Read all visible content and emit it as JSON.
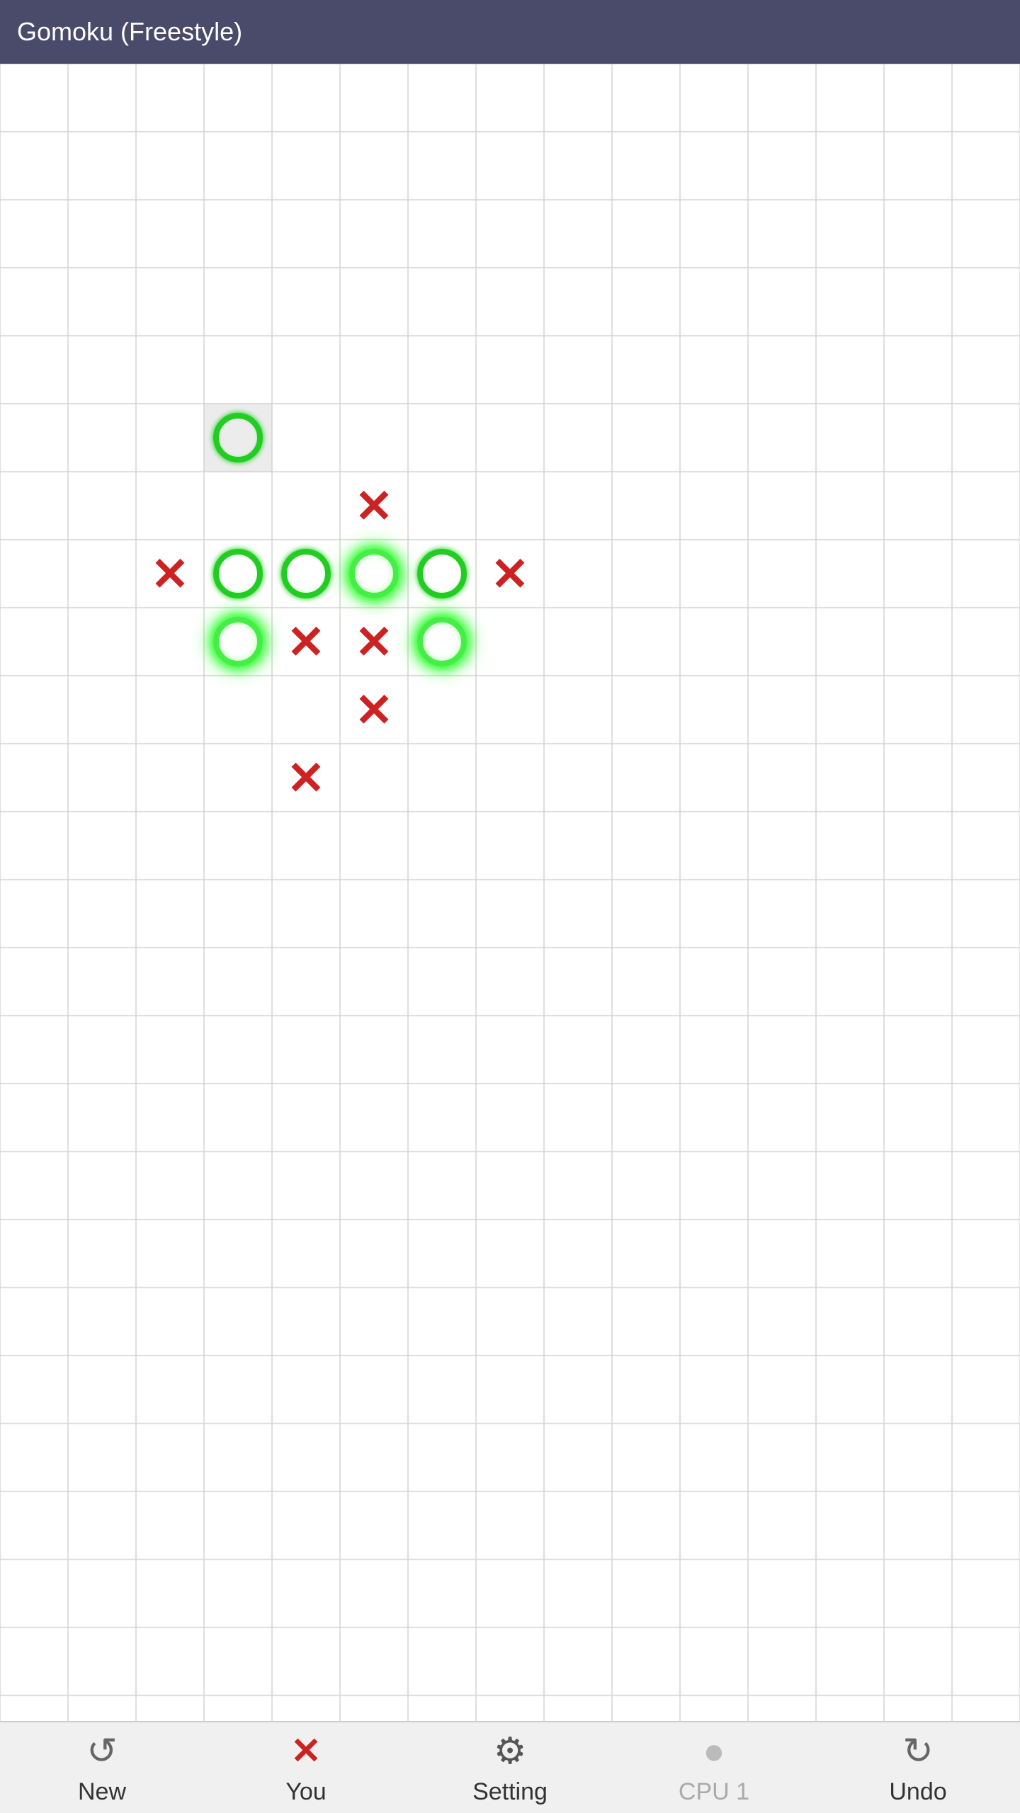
{
  "titleBar": {
    "title": "Gomoku (Freestyle)"
  },
  "board": {
    "cols": 15,
    "rows": 22,
    "cellSize": 96,
    "pieces": [
      {
        "type": "O",
        "col": 3,
        "row": 5,
        "highlighted": true,
        "bright": false
      },
      {
        "type": "X",
        "col": 5,
        "row": 6,
        "highlighted": false
      },
      {
        "type": "X",
        "col": 2,
        "row": 7,
        "highlighted": false
      },
      {
        "type": "O",
        "col": 3,
        "row": 7,
        "highlighted": false,
        "bright": false
      },
      {
        "type": "O",
        "col": 4,
        "row": 7,
        "highlighted": false,
        "bright": false
      },
      {
        "type": "O",
        "col": 5,
        "row": 7,
        "highlighted": false,
        "bright": true
      },
      {
        "type": "O",
        "col": 6,
        "row": 7,
        "highlighted": false,
        "bright": false
      },
      {
        "type": "X",
        "col": 7,
        "row": 7,
        "highlighted": false
      },
      {
        "type": "O",
        "col": 3,
        "row": 8,
        "highlighted": false,
        "bright": true
      },
      {
        "type": "X",
        "col": 4,
        "row": 8,
        "highlighted": false
      },
      {
        "type": "X",
        "col": 5,
        "row": 8,
        "highlighted": false
      },
      {
        "type": "O",
        "col": 6,
        "row": 8,
        "highlighted": false,
        "bright": true
      },
      {
        "type": "X",
        "col": 5,
        "row": 9,
        "highlighted": false
      },
      {
        "type": "X",
        "col": 4,
        "row": 10,
        "highlighted": false
      }
    ]
  },
  "bottomBar": {
    "buttons": [
      {
        "id": "new",
        "label": "New",
        "icon": "arrow-forward"
      },
      {
        "id": "you",
        "label": "You",
        "icon": "x-mark"
      },
      {
        "id": "setting",
        "label": "Setting",
        "icon": "gear"
      },
      {
        "id": "cpu1",
        "label": "CPU 1",
        "icon": "none",
        "dim": true
      },
      {
        "id": "undo",
        "label": "Undo",
        "icon": "arrow-back"
      }
    ]
  }
}
